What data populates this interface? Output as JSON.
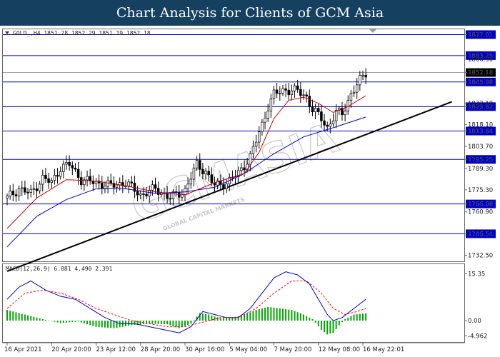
{
  "header": {
    "title": "Chart Analysis for Clients of GCM Asia"
  },
  "price_info": "GOLD_,H4  1851.28 1852.29 1851.19 1852.18",
  "macd_info": "MACD(12,26,9) 6.881 4.490 2.391",
  "watermark": {
    "main": "GCMASIA",
    "sub": "GLOBAL CAPITAL MARKETS"
  },
  "colors": {
    "header_bg": "#15405f",
    "level_line": "#0000cc",
    "trend_line": "#000000",
    "ma_fast": "#cc0000",
    "ma_slow": "#0000cc",
    "macd_line": "#0000cc",
    "signal_line": "#ff0000",
    "histogram": "#00aa00"
  },
  "chart_data": [
    {
      "type": "candlestick",
      "title": "",
      "symbol": "GOLD_",
      "timeframe": "H4",
      "ylim": [
        1728.5,
        1880.5
      ],
      "price_ticks": [
        "1877.01",
        "1863.25",
        "1860.90",
        "1852.18",
        "1845.98",
        "1832.10",
        "1829.82",
        "1818.10",
        "1813.84",
        "1803.70",
        "1795.25",
        "1789.30",
        "1775.30",
        "1766.08",
        "1760.90",
        "1746.54",
        "1732.50"
      ],
      "x_ticks": [
        "16 Apr 2021",
        "20 Apr 20:00",
        "23 Apr 12:00",
        "28 Apr 20:00",
        "30 Apr 16:00",
        "5 May 04:00",
        "7 May 20:00",
        "12 May 08:00",
        "16 May 22:01"
      ],
      "x_tick_index": [
        0,
        15,
        30,
        45,
        60,
        75,
        90,
        105,
        120
      ],
      "horizontal_levels": [
        {
          "value": 1877.01,
          "label": "1877.01"
        },
        {
          "value": 1863.25,
          "label": "1863.25"
        },
        {
          "value": 1845.98,
          "label": "1845.98"
        },
        {
          "value": 1829.82,
          "label": "1829.82"
        },
        {
          "value": 1813.84,
          "label": "1813.84"
        },
        {
          "value": 1795.25,
          "label": "1795.25"
        },
        {
          "value": 1766.08,
          "label": "1766.08"
        },
        {
          "value": 1746.54,
          "label": "1746.54"
        }
      ],
      "current_price": {
        "value": 1852.18,
        "label": "1852.18"
      },
      "trendline": [
        {
          "bar": 0,
          "price": 1722
        },
        {
          "bar": 150,
          "price": 1833
        }
      ],
      "close_path": [
        {
          "bar": 0,
          "price": 1770
        },
        {
          "bar": 4,
          "price": 1776
        },
        {
          "bar": 8,
          "price": 1773
        },
        {
          "bar": 12,
          "price": 1783
        },
        {
          "bar": 15,
          "price": 1780
        },
        {
          "bar": 18,
          "price": 1790
        },
        {
          "bar": 21,
          "price": 1792
        },
        {
          "bar": 25,
          "price": 1782
        },
        {
          "bar": 30,
          "price": 1780
        },
        {
          "bar": 35,
          "price": 1778
        },
        {
          "bar": 40,
          "price": 1780
        },
        {
          "bar": 45,
          "price": 1772
        },
        {
          "bar": 50,
          "price": 1776
        },
        {
          "bar": 55,
          "price": 1770
        },
        {
          "bar": 60,
          "price": 1775
        },
        {
          "bar": 64,
          "price": 1792
        },
        {
          "bar": 67,
          "price": 1787
        },
        {
          "bar": 70,
          "price": 1778
        },
        {
          "bar": 74,
          "price": 1780
        },
        {
          "bar": 78,
          "price": 1786
        },
        {
          "bar": 82,
          "price": 1797
        },
        {
          "bar": 86,
          "price": 1818
        },
        {
          "bar": 88,
          "price": 1830
        },
        {
          "bar": 90,
          "price": 1838
        },
        {
          "bar": 94,
          "price": 1841
        },
        {
          "bar": 98,
          "price": 1840
        },
        {
          "bar": 101,
          "price": 1836
        },
        {
          "bar": 103,
          "price": 1828
        },
        {
          "bar": 106,
          "price": 1822
        },
        {
          "bar": 108,
          "price": 1816
        },
        {
          "bar": 111,
          "price": 1826
        },
        {
          "bar": 113,
          "price": 1825
        },
        {
          "bar": 116,
          "price": 1838
        },
        {
          "bar": 119,
          "price": 1847
        },
        {
          "bar": 121,
          "price": 1852
        }
      ],
      "ma_fast": [
        {
          "bar": 0,
          "price": 1750
        },
        {
          "bar": 10,
          "price": 1770
        },
        {
          "bar": 20,
          "price": 1782
        },
        {
          "bar": 30,
          "price": 1781
        },
        {
          "bar": 40,
          "price": 1778
        },
        {
          "bar": 50,
          "price": 1774
        },
        {
          "bar": 60,
          "price": 1772
        },
        {
          "bar": 70,
          "price": 1780
        },
        {
          "bar": 80,
          "price": 1786
        },
        {
          "bar": 85,
          "price": 1800
        },
        {
          "bar": 90,
          "price": 1822
        },
        {
          "bar": 95,
          "price": 1834
        },
        {
          "bar": 100,
          "price": 1836
        },
        {
          "bar": 105,
          "price": 1832
        },
        {
          "bar": 110,
          "price": 1826
        },
        {
          "bar": 115,
          "price": 1830
        },
        {
          "bar": 121,
          "price": 1837
        }
      ],
      "ma_slow": [
        {
          "bar": 0,
          "price": 1738
        },
        {
          "bar": 10,
          "price": 1758
        },
        {
          "bar": 20,
          "price": 1769
        },
        {
          "bar": 30,
          "price": 1776
        },
        {
          "bar": 40,
          "price": 1776
        },
        {
          "bar": 50,
          "price": 1773
        },
        {
          "bar": 60,
          "price": 1774
        },
        {
          "bar": 70,
          "price": 1777
        },
        {
          "bar": 80,
          "price": 1786
        },
        {
          "bar": 90,
          "price": 1799
        },
        {
          "bar": 100,
          "price": 1810
        },
        {
          "bar": 110,
          "price": 1816
        },
        {
          "bar": 121,
          "price": 1823
        }
      ]
    },
    {
      "type": "macd",
      "ylim": [
        -7,
        18.5
      ],
      "y_ticks": [
        "15.35",
        "0.00",
        "-4.962"
      ],
      "macd": [
        {
          "bar": 0,
          "v": 7
        },
        {
          "bar": 4,
          "v": 11
        },
        {
          "bar": 8,
          "v": 13
        },
        {
          "bar": 13,
          "v": 10
        },
        {
          "bar": 18,
          "v": 8
        },
        {
          "bar": 23,
          "v": 7
        },
        {
          "bar": 28,
          "v": 4
        },
        {
          "bar": 33,
          "v": 1
        },
        {
          "bar": 38,
          "v": -1
        },
        {
          "bar": 43,
          "v": -1
        },
        {
          "bar": 48,
          "v": -2
        },
        {
          "bar": 53,
          "v": -3
        },
        {
          "bar": 58,
          "v": -4
        },
        {
          "bar": 62,
          "v": -2
        },
        {
          "bar": 66,
          "v": 3
        },
        {
          "bar": 70,
          "v": 2
        },
        {
          "bar": 74,
          "v": 1
        },
        {
          "bar": 78,
          "v": 1
        },
        {
          "bar": 82,
          "v": 4
        },
        {
          "bar": 86,
          "v": 9
        },
        {
          "bar": 90,
          "v": 14
        },
        {
          "bar": 94,
          "v": 16
        },
        {
          "bar": 98,
          "v": 15
        },
        {
          "bar": 102,
          "v": 12
        },
        {
          "bar": 105,
          "v": 7
        },
        {
          "bar": 108,
          "v": 2
        },
        {
          "bar": 110,
          "v": 0
        },
        {
          "bar": 113,
          "v": 1
        },
        {
          "bar": 117,
          "v": 4
        },
        {
          "bar": 121,
          "v": 7
        }
      ],
      "signal": [
        {
          "bar": 0,
          "v": 4
        },
        {
          "bar": 6,
          "v": 9
        },
        {
          "bar": 12,
          "v": 10
        },
        {
          "bar": 18,
          "v": 9
        },
        {
          "bar": 24,
          "v": 7
        },
        {
          "bar": 30,
          "v": 4
        },
        {
          "bar": 36,
          "v": 2
        },
        {
          "bar": 42,
          "v": 0
        },
        {
          "bar": 48,
          "v": -1
        },
        {
          "bar": 54,
          "v": -2
        },
        {
          "bar": 60,
          "v": -2
        },
        {
          "bar": 64,
          "v": -1
        },
        {
          "bar": 68,
          "v": 0
        },
        {
          "bar": 72,
          "v": 1
        },
        {
          "bar": 78,
          "v": 1
        },
        {
          "bar": 84,
          "v": 4
        },
        {
          "bar": 90,
          "v": 9
        },
        {
          "bar": 96,
          "v": 13
        },
        {
          "bar": 101,
          "v": 13
        },
        {
          "bar": 106,
          "v": 9
        },
        {
          "bar": 110,
          "v": 4
        },
        {
          "bar": 114,
          "v": 2
        },
        {
          "bar": 118,
          "v": 3
        },
        {
          "bar": 121,
          "v": 4
        }
      ],
      "histogram": [
        {
          "bar": 0,
          "v": 3.5
        },
        {
          "bar": 6,
          "v": 2
        },
        {
          "bar": 12,
          "v": 0.5
        },
        {
          "bar": 18,
          "v": -0.8
        },
        {
          "bar": 24,
          "v": -0.3
        },
        {
          "bar": 30,
          "v": -2
        },
        {
          "bar": 36,
          "v": -2.5
        },
        {
          "bar": 42,
          "v": -1.5
        },
        {
          "bar": 48,
          "v": -1
        },
        {
          "bar": 54,
          "v": -1.2
        },
        {
          "bar": 58,
          "v": -2.5
        },
        {
          "bar": 62,
          "v": -1
        },
        {
          "bar": 65,
          "v": 2.5
        },
        {
          "bar": 68,
          "v": 2
        },
        {
          "bar": 72,
          "v": 0.8
        },
        {
          "bar": 76,
          "v": 1
        },
        {
          "bar": 80,
          "v": 2
        },
        {
          "bar": 84,
          "v": 3.5
        },
        {
          "bar": 88,
          "v": 4.5
        },
        {
          "bar": 92,
          "v": 4
        },
        {
          "bar": 96,
          "v": 3.5
        },
        {
          "bar": 100,
          "v": 2
        },
        {
          "bar": 103,
          "v": 0.5
        },
        {
          "bar": 106,
          "v": -3
        },
        {
          "bar": 108,
          "v": -4.5
        },
        {
          "bar": 110,
          "v": -4
        },
        {
          "bar": 112,
          "v": -1.5
        },
        {
          "bar": 114,
          "v": 0.5
        },
        {
          "bar": 117,
          "v": 2
        },
        {
          "bar": 121,
          "v": 2.4
        }
      ]
    }
  ]
}
